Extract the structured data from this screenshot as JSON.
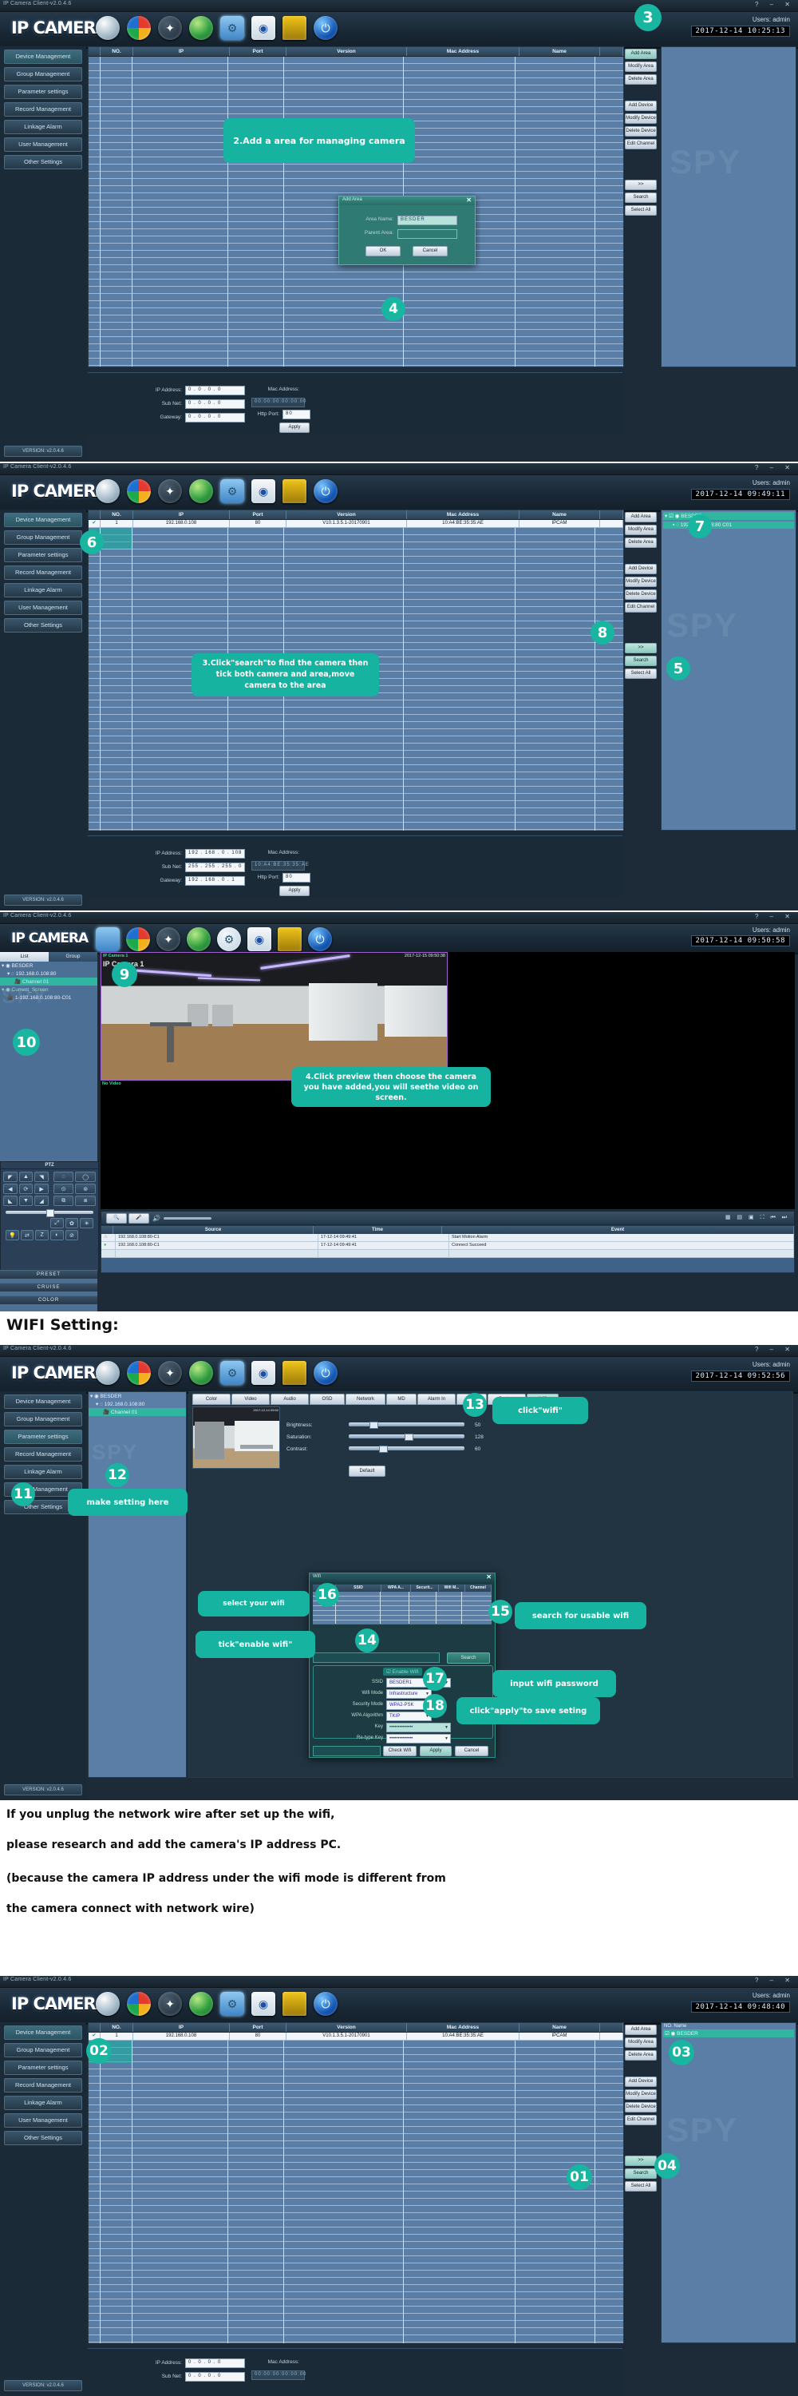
{
  "app": {
    "window_title": "IP Camera Client-v2.0.4.6",
    "logo": "IP CAMERA",
    "users_label": "Users: admin",
    "version_badge": "VERSION: v2.0.4.6",
    "window_buttons": "? – ✕",
    "toolbar_icons": [
      {
        "name": "camera-icon",
        "glyph": "◉"
      },
      {
        "name": "playback-icon",
        "glyph": "▶"
      },
      {
        "name": "ptz-wheel-icon",
        "glyph": "✦"
      },
      {
        "name": "globe-icon",
        "glyph": "🌐"
      },
      {
        "name": "settings-gear-icon",
        "glyph": "⚙"
      },
      {
        "name": "log-document-icon",
        "glyph": "🖫"
      },
      {
        "name": "lock-icon",
        "glyph": "🔒"
      },
      {
        "name": "power-icon",
        "glyph": "⏻"
      }
    ]
  },
  "sidebar": {
    "items": [
      {
        "label": "Device Management"
      },
      {
        "label": "Group Management"
      },
      {
        "label": "Parameter settings"
      },
      {
        "label": "Record Management"
      },
      {
        "label": "Linkage Alarm"
      },
      {
        "label": "User Management"
      },
      {
        "label": "Other Settings"
      }
    ]
  },
  "device_table": {
    "columns": [
      "NO.",
      "IP",
      "Port",
      "Version",
      "Mac Address",
      "Name"
    ],
    "rows": [
      {
        "no": "1",
        "ip": "192.168.0.108",
        "port": "80",
        "version": "V10.1.3.5.1-20170901",
        "mac": "10:A4:BE:35:35:AE",
        "name": "IPCAM"
      }
    ]
  },
  "right_buttons": {
    "group_area": [
      "Add Area",
      "Modify Area",
      "Delete Area"
    ],
    "group_device": [
      "Add Device",
      "Modify Device",
      "Delete Device",
      "Edit Channel"
    ],
    "group_bottom": [
      ">>",
      "Search",
      "Select All"
    ]
  },
  "ip_form": {
    "ip_label": "IP Address:",
    "ip_value": "0 . 0 . 0 . 0",
    "subnet_label": "Sub Net:",
    "subnet_value": "0 . 0 . 0 . 0",
    "gateway_label": "Gateway:",
    "gateway_value": "0 . 0 . 0 . 0",
    "mac_label": "Mac Address:",
    "mac_value": "00:00:00:00:00:00",
    "http_label": "Http Port:",
    "http_value": "80",
    "apply_label": "Apply"
  },
  "ip_form_filled": {
    "ip_value": "192 . 168 . 0 . 108",
    "subnet_value": "255 . 255 . 255 . 0",
    "gateway_value": "192 . 168 . 0 . 1",
    "mac_value": "10:A4:BE:35:35:AE",
    "http_value": "80"
  },
  "panel1": {
    "clock": "2017-12-14  10:25:13",
    "badge3": "3",
    "badge4": "4",
    "bubble": "2.Add a area for managing camera",
    "dialog": {
      "title": "Add Area",
      "close": "✕",
      "area_name_label": "Area Name:",
      "area_name_value": "BESDER",
      "parent_area_label": "Parent Area:",
      "parent_area_value": "",
      "ok_label": "OK",
      "cancel_label": "Cancel"
    }
  },
  "panel2": {
    "clock": "2017-12-14  09:49:11",
    "badge5": "5",
    "badge6": "6",
    "badge7": "7",
    "badge8": "8",
    "bubble": "3.Click\"search\"to find the camera then tick both camera and area,move camera to the area",
    "tree": [
      {
        "label": "BESDER",
        "level": 0,
        "selected": true
      },
      {
        "label": "192.168.0.108:80 C01",
        "level": 1,
        "selected": true
      }
    ]
  },
  "panel3": {
    "clock": "2017-12-14  09:50:58",
    "badge9": "9",
    "badge10": "10",
    "bubble": "4.Click preview then choose the camera you have added,you will seethe video on screen.",
    "tabs": [
      "List",
      "Group"
    ],
    "tree": [
      {
        "label": "BESDER",
        "level": 0
      },
      {
        "label": "192.168.0.108:80",
        "level": 1
      },
      {
        "label": "Channel 01",
        "level": 2,
        "selected": true
      },
      {
        "label": "Current_Screen",
        "level": 0
      },
      {
        "label": "1-192.168.0.108:80-C01",
        "level": 1
      }
    ],
    "video": {
      "channel_label": "IP Camera  1",
      "overlay_text": "IP Camera 1",
      "timestamp": "2017-12-15  09:50:38",
      "no_video_label": "No Video"
    },
    "ptz": {
      "title": "PTZ",
      "preset_label": "PRESET",
      "cruise_label": "CRUISE",
      "color_label": "COLOR",
      "keys": [
        "◤",
        "▲",
        "◥",
        "◀",
        "⟳",
        "▶",
        "◣",
        "▼",
        "◢"
      ],
      "zoom_keys": [
        "◌",
        "◯",
        "⊙",
        "⊚",
        "⧉",
        "⧈"
      ],
      "tool_keys": [
        "☀",
        "💡",
        "⇄",
        "Z",
        "◐",
        "⊘",
        "⤢",
        "✿"
      ]
    },
    "log": {
      "toolbar_icons": [
        "search-icon",
        "mic-icon",
        "speaker-icon"
      ],
      "columns": [
        "Source",
        "Time",
        "Event"
      ],
      "rows": [
        {
          "icon": "warning",
          "source": "192.168.0.108:80-C1",
          "time": "17-12-14 09:49:41",
          "event": "Start Motion Alarm"
        },
        {
          "icon": "ok",
          "source": "192.168.0.108:80-C1",
          "time": "17-12-14 09:49:41",
          "event": "Connect Succeed"
        }
      ]
    }
  },
  "wifi_section": {
    "heading": "WIFI Setting:",
    "clock": "2017-12-14  09:52:56",
    "badges": {
      "b11": "11",
      "b12": "12",
      "b13": "13",
      "b14": "14",
      "b15": "15",
      "b16": "16",
      "b17": "17",
      "b18": "18"
    },
    "bubbles": {
      "make_setting": "make setting here",
      "click_wifi": "click\"wifi\"",
      "select_wifi": "select your wifi",
      "search_usable": "search for usable wifi",
      "tick_enable": "tick\"enable wifi\"",
      "input_password": "input wifi password",
      "click_apply": "click\"apply\"to save seting"
    },
    "tree": [
      {
        "label": "BESDER",
        "level": 0
      },
      {
        "label": "192.168.0.108:80",
        "level": 1
      },
      {
        "label": "Channel 01",
        "level": 2,
        "selected": true
      }
    ],
    "param_tabs": [
      "Color",
      "Video",
      "Audio",
      "OSD",
      "Network",
      "MD",
      "Alarm In",
      "PTZ",
      "System",
      "Wifi"
    ],
    "color_panel": {
      "rows": [
        {
          "label": "Brightness:",
          "value": "50",
          "pct": 22
        },
        {
          "label": "Saturation:",
          "value": "128",
          "pct": 52
        },
        {
          "label": "Contrast:",
          "value": "60",
          "pct": 30
        }
      ],
      "default_label": "Default"
    },
    "wifi_dialog": {
      "title": "Wifi",
      "close": "✕",
      "columns": [
        "RSSI",
        "SSID",
        "WPA A...",
        "Securit...",
        "Wifi M...",
        "Channel"
      ],
      "search_input": "",
      "search_label": "Search",
      "enable_label": "Enable Wifi",
      "fields": [
        {
          "label": "SSID",
          "value": "BESDER1",
          "type": "text"
        },
        {
          "label": "Wifi Mode",
          "value": "Infrastructure",
          "type": "select"
        },
        {
          "label": "Security Mode",
          "value": "WPA2-PSK",
          "type": "select"
        },
        {
          "label": "WPA Algorithm",
          "value": "TKIP",
          "type": "select"
        },
        {
          "label": "Key",
          "value": "••••••••••••••",
          "type": "password"
        },
        {
          "label": "Re-type Key",
          "value": "••••••••••••••",
          "type": "password"
        }
      ],
      "status_input": "",
      "check_label": "Check Wifi",
      "apply_label": "Apply",
      "cancel_label": "Cancel"
    }
  },
  "note_block": {
    "lines": [
      "If you unplug the network wire after set up the wifi,",
      "please research and add the camera's IP address PC.",
      "(because the camera IP address under the wifi mode is different from",
      "the camera connect with network wire)"
    ]
  },
  "panel5": {
    "clock": "2017-12-14  09:48:40",
    "badges": {
      "b01": "01",
      "b02": "02",
      "b03": "03",
      "b04": "04"
    },
    "tree": [
      {
        "label": "BESDER",
        "level": 0,
        "selected": true
      }
    ],
    "tree_title": "NO.  Name"
  },
  "colors": {
    "accent": "#16b3a0",
    "panel_bg": "#1d2b38",
    "table_blue": "#5a7ea6",
    "header_grad_top": "#26394a"
  }
}
